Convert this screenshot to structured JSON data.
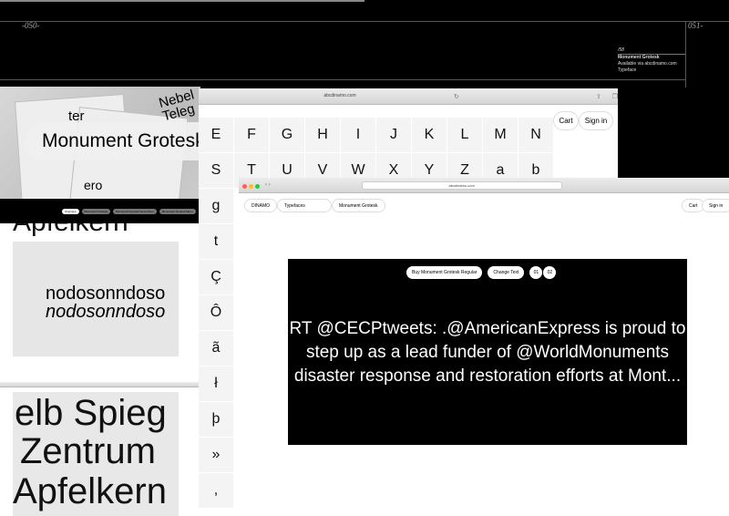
{
  "spread": {
    "left_page": "-050-",
    "right_page": "051-"
  },
  "info": {
    "number": "/58",
    "title": "Monument Grotesk",
    "availability": "Available via abcdinamo.com",
    "category": "Typeface"
  },
  "panel1": {
    "hero_text": "Monument Grotesk",
    "photo_words": [
      "ter",
      "Nebel",
      "Teleg",
      "ero"
    ],
    "tabs": [
      "Overview",
      "Monument Grotesk",
      "Monument Grotesk Semi-Mono",
      "Monument Grotesk Mono"
    ]
  },
  "browser2": {
    "url": "abcdinamo.com",
    "cart": "Cart",
    "sign_in": "Sign in",
    "row1": [
      "E",
      "F",
      "G",
      "H",
      "I",
      "J",
      "K",
      "L",
      "M",
      "N"
    ],
    "row2": [
      "S",
      "T",
      "U",
      "V",
      "W",
      "X",
      "Y",
      "Z",
      "a",
      "b"
    ],
    "column": [
      "g",
      "t",
      "Ç",
      "Ô",
      "ã",
      "ł",
      "þ",
      "»",
      ","
    ]
  },
  "browser3": {
    "url": "abcdinamo.com",
    "nav": [
      "DINAMO",
      "Typefaces",
      "Monument Grotesk"
    ],
    "cart": "Cart",
    "sign_in": "Sign in",
    "buy_button": "Buy Monument Grotesk Regular",
    "change_text": "Change Text",
    "pages": [
      "01",
      "02"
    ],
    "quote": "RT @CECPtweets: .@AmericanExpress is proud to step up as a lead funder of @WorldMonuments disaster response and restoration efforts at Mont..."
  },
  "panel4": {
    "line1": "Apfelkern",
    "line2": "nodosonndoso",
    "line3": "nodosonndoso"
  },
  "panel5": {
    "lines": [
      "elb Spieg",
      "Zentrum",
      "Apfelkern"
    ]
  },
  "colors": {
    "background": "#000000",
    "traffic_red": "#ff5f57",
    "traffic_yellow": "#febc2e",
    "traffic_green": "#28c840"
  }
}
